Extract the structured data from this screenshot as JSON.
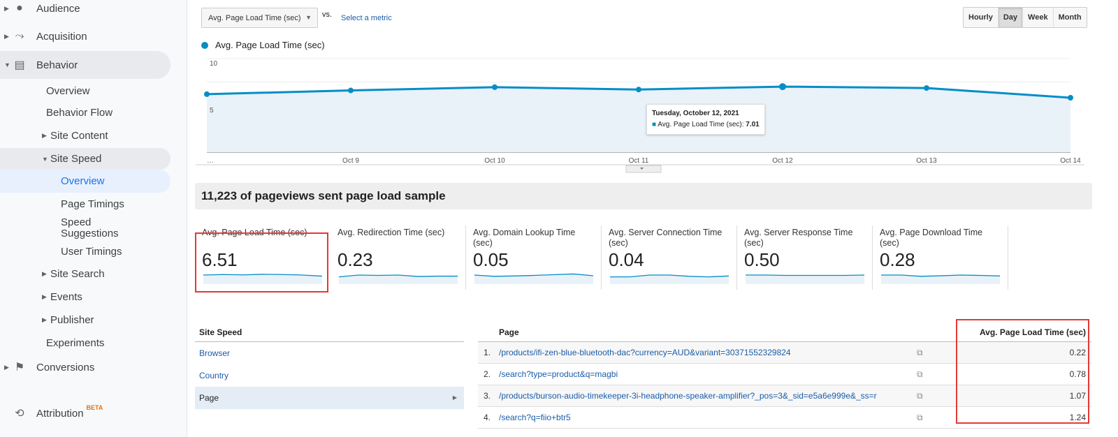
{
  "sidebar": {
    "items": [
      {
        "label": "Audience",
        "icon": "person-icon",
        "expanded": false
      },
      {
        "label": "Acquisition",
        "icon": "acquisition-icon",
        "expanded": false
      },
      {
        "label": "Behavior",
        "icon": "behavior-icon",
        "expanded": true
      },
      {
        "label": "Overview"
      },
      {
        "label": "Behavior Flow"
      },
      {
        "label": "Site Content"
      },
      {
        "label": "Site Speed"
      },
      {
        "label": "Overview",
        "active": true
      },
      {
        "label": "Page Timings"
      },
      {
        "label": "Speed Suggestions"
      },
      {
        "label": "User Timings"
      },
      {
        "label": "Site Search"
      },
      {
        "label": "Events"
      },
      {
        "label": "Publisher"
      },
      {
        "label": "Experiments"
      },
      {
        "label": "Conversions",
        "icon": "flag-icon"
      },
      {
        "label": "Attribution",
        "icon": "attribution-icon",
        "badge": "BETA"
      }
    ]
  },
  "toolbar": {
    "metric": "Avg. Page Load Time (sec)",
    "vs": "vs.",
    "select_metric": "Select a metric",
    "intervals": [
      "Hourly",
      "Day",
      "Week",
      "Month"
    ],
    "selected_interval": "Day"
  },
  "chart_data": {
    "type": "area",
    "series": [
      {
        "name": "Avg. Page Load Time (sec)",
        "values": [
          6.2,
          6.6,
          6.95,
          6.7,
          7.01,
          6.86,
          5.82
        ]
      }
    ],
    "categories": [
      "…",
      "Oct 9",
      "Oct 10",
      "Oct 11",
      "Oct 12",
      "Oct 13",
      "Oct 14"
    ],
    "ylim": [
      0,
      10
    ],
    "yticks": [
      "10",
      "5"
    ],
    "grid": true,
    "color": "#058dc7",
    "tooltip": {
      "title": "Tuesday, October 12, 2021",
      "label": "Avg. Page Load Time (sec):",
      "value": "7.01"
    }
  },
  "sample": "11,223 of pageviews sent page load sample",
  "tiles": [
    {
      "label": "Avg. Page Load Time (sec)",
      "value": "6.51",
      "spark": [
        5,
        5.3,
        5.1,
        5.4,
        5.3,
        5,
        4.4
      ]
    },
    {
      "label": "Avg. Redirection Time (sec)",
      "value": "0.23",
      "spark": [
        4,
        5,
        4.8,
        5,
        4.2,
        4.4,
        4.4
      ]
    },
    {
      "label": "Avg. Domain Lookup Time (sec)",
      "value": "0.05",
      "spark": [
        5,
        4.3,
        4.5,
        4.8,
        5.2,
        5.6,
        4.6
      ]
    },
    {
      "label": "Avg. Server Connection Time (sec)",
      "value": "0.04",
      "spark": [
        4,
        4,
        5,
        5,
        4.3,
        4,
        4.5
      ]
    },
    {
      "label": "Avg. Server Response Time (sec)",
      "value": "0.50",
      "spark": [
        5,
        5,
        4.8,
        4.8,
        4.8,
        4.8,
        5
      ]
    },
    {
      "label": "Avg. Page Download Time (sec)",
      "value": "0.28",
      "spark": [
        5,
        5,
        4.3,
        4.6,
        5,
        4.8,
        4.5
      ]
    }
  ],
  "site_speed": {
    "header": "Site Speed",
    "rows": [
      "Browser",
      "Country",
      "Page"
    ],
    "selected": "Page"
  },
  "page_table": {
    "col_page": "Page",
    "col_value": "Avg. Page Load Time (sec)",
    "rows": [
      {
        "n": "1.",
        "page": "/products/ifi-zen-blue-bluetooth-dac?currency=AUD&variant=30371552329824",
        "value": "0.22"
      },
      {
        "n": "2.",
        "page": "/search?type=product&q=magbi",
        "value": "0.78"
      },
      {
        "n": "3.",
        "page": "/products/burson-audio-timekeeper-3i-headphone-speaker-amplifier?_pos=3&_sid=e5a6e999e&_ss=r",
        "value": "1.07"
      },
      {
        "n": "4.",
        "page": "/search?q=fiio+btr5",
        "value": "1.24"
      }
    ]
  }
}
